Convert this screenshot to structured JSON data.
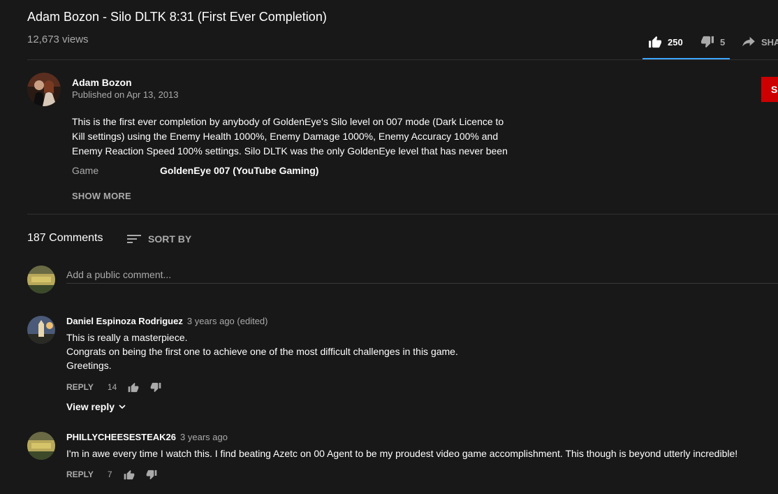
{
  "video": {
    "title": "Adam Bozon - Silo DLTK 8:31 (First Ever Completion)",
    "views": "12,673 views",
    "likes": "250",
    "dislikes": "5",
    "share_label": "SHARE"
  },
  "channel": {
    "name": "Adam Bozon",
    "published": "Published on Apr 13, 2013",
    "subscribe_label": "S",
    "description": [
      "This is the first ever completion by anybody of GoldenEye's Silo level on 007 mode (Dark Licence to",
      "Kill settings) using the Enemy Health 1000%, Enemy Damage 1000%, Enemy Accuracy 100% and",
      "Enemy Reaction Speed 100% settings. Silo DLTK was the only GoldenEye level that has never been"
    ],
    "meta_key": "Game",
    "meta_value": "GoldenEye 007 (YouTube Gaming)",
    "show_more": "SHOW MORE"
  },
  "comments_section": {
    "count": "187 Comments",
    "sort_label": "SORT BY",
    "add_placeholder": "Add a public comment...",
    "comments": [
      {
        "author": "Daniel Espinoza Rodriguez",
        "time": "3 years ago (edited)",
        "lines": [
          "This is really a masterpiece.",
          "Congrats on being the first one to achieve one of the most difficult challenges in this game.",
          "Greetings."
        ],
        "reply_label": "REPLY",
        "likes": "14",
        "view_replies": "View reply"
      },
      {
        "author": "PHILLYCHEESESTEAK26",
        "time": "3 years ago",
        "lines": [
          "I'm in awe every time I watch this. I find beating Azetc on 00 Agent to be my proudest video game accomplishment. This though is beyond utterly incredible!"
        ],
        "reply_label": "REPLY",
        "likes": "7"
      }
    ]
  },
  "colors": {
    "background": "#181818",
    "text_primary": "#ffffff",
    "text_secondary": "#aaaaaa",
    "accent_blue": "#3ea6ff",
    "subscribe_red": "#cc0000",
    "divider": "#303030"
  }
}
